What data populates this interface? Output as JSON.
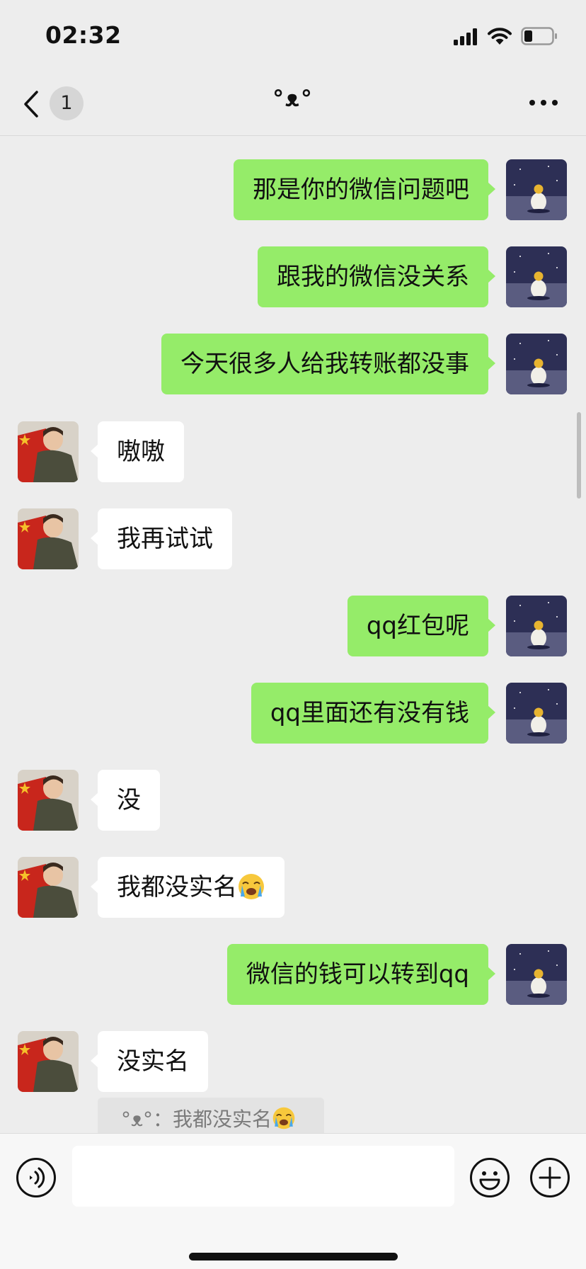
{
  "status": {
    "time": "02:32"
  },
  "nav": {
    "unread_count": "1",
    "title": "°ᴥ°"
  },
  "messages": [
    {
      "side": "out",
      "text": "那是你的微信问题吧"
    },
    {
      "side": "out",
      "text": "跟我的微信没关系"
    },
    {
      "side": "out",
      "text": "今天很多人给我转账都没事"
    },
    {
      "side": "in",
      "text": "嗷嗷"
    },
    {
      "side": "in",
      "text": "我再试试"
    },
    {
      "side": "out",
      "text": "qq红包呢"
    },
    {
      "side": "out",
      "text": "qq里面还有没有钱"
    },
    {
      "side": "in",
      "text": "没"
    },
    {
      "side": "in",
      "text": "我都没实名",
      "emoji": "loudly-crying-face"
    },
    {
      "side": "out",
      "text": "微信的钱可以转到qq"
    },
    {
      "side": "in",
      "text": "没实名"
    }
  ],
  "quote": {
    "sender": "°ᴥ°",
    "separator": "：",
    "text": "我都没实名",
    "emoji": "loudly-crying-face"
  },
  "input": {
    "value": ""
  },
  "icons": {
    "back": "chevron-left-icon",
    "more": "more-dots-icon",
    "voice": "voice-icon",
    "emoji": "emoji-icon",
    "plus": "plus-circle-icon"
  },
  "colors": {
    "outgoing_bubble": "#95ec69",
    "incoming_bubble": "#ffffff",
    "background": "#ededed"
  }
}
